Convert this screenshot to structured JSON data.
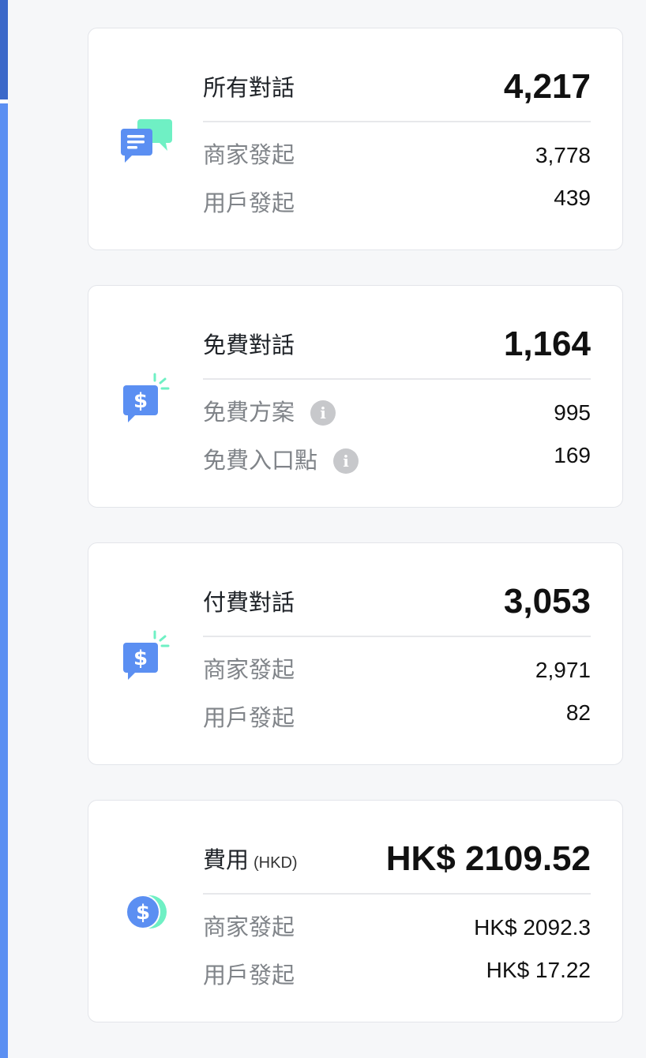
{
  "cards": [
    {
      "title": "所有對話",
      "total": "4,217",
      "icon": "chat-bubbles-icon",
      "rows": [
        {
          "label": "商家發起",
          "value": "3,778"
        },
        {
          "label": "用戶發起",
          "value": "439"
        }
      ]
    },
    {
      "title": "免費對話",
      "total": "1,164",
      "icon": "free-chat-icon",
      "rows": [
        {
          "label": "免費方案",
          "value": "995",
          "info_icon": "info-icon"
        },
        {
          "label": "免費入口點",
          "value": "169",
          "info_icon": "info-icon"
        }
      ]
    },
    {
      "title": "付費對話",
      "total": "3,053",
      "icon": "paid-chat-icon",
      "rows": [
        {
          "label": "商家發起",
          "value": "2,971"
        },
        {
          "label": "用戶發起",
          "value": "82"
        }
      ]
    },
    {
      "title": "費用",
      "unit": "(HKD)",
      "total": "HK$ 2109.52",
      "icon": "coin-icon",
      "rows": [
        {
          "label": "商家發起",
          "value": "HK$ 2092.3"
        },
        {
          "label": "用戶發起",
          "value": "HK$ 17.22"
        }
      ]
    }
  ],
  "colors": {
    "accent_blue": "#5b8ff2",
    "accent_green": "#6ff0c4",
    "sidebar_dark": "#3b68c9"
  }
}
